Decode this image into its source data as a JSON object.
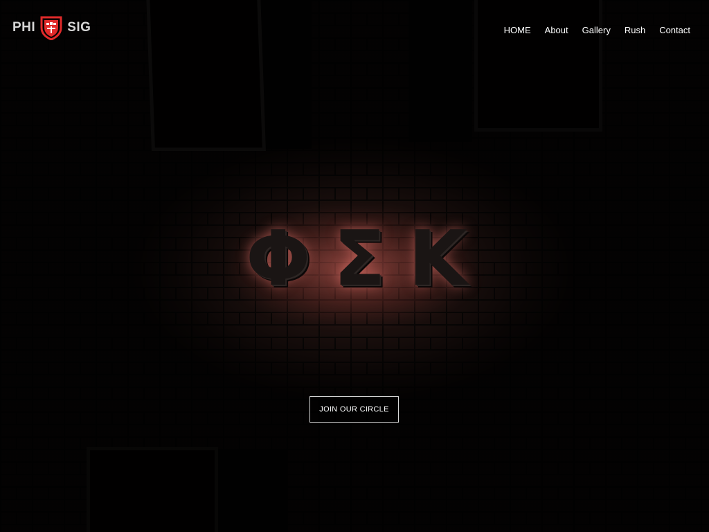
{
  "brand": {
    "left_text": "PHI",
    "right_text": "SIG",
    "crest_icon": "shield-crest-icon",
    "crest_color": "#e02a2a"
  },
  "nav": {
    "items": [
      {
        "label": "HOME"
      },
      {
        "label": "About"
      },
      {
        "label": "Gallery"
      },
      {
        "label": "Rush"
      },
      {
        "label": "Contact"
      }
    ]
  },
  "hero": {
    "sign_letters": [
      "Φ",
      "Σ",
      "Κ"
    ],
    "cta_label": "JOIN OUR CIRCLE"
  }
}
